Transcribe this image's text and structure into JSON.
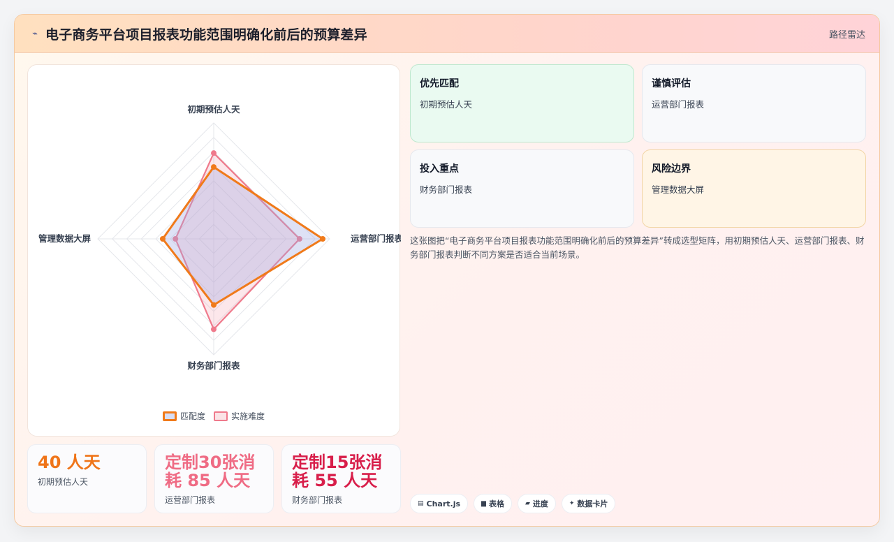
{
  "header": {
    "icon": "line-chart-icon",
    "title": "电子商务平台项目报表功能范围明确化前后的预算差异",
    "nav_label": "路径雷达"
  },
  "chart_data": {
    "type": "radar",
    "axes": [
      "初期预估人天",
      "运营部门报表",
      "财务部门报表",
      "管理数据大屏"
    ],
    "series": [
      {
        "name": "匹配度",
        "values": [
          62,
          94,
          57,
          44
        ],
        "color": "#f07a1a"
      },
      {
        "name": "实施难度",
        "values": [
          74,
          74,
          78,
          33
        ],
        "color": "#ef7a8c"
      }
    ],
    "rmax": 100,
    "rings": 8,
    "legend_position": "bottom"
  },
  "stats": [
    {
      "value": "40 人天",
      "label": "初期预估人天"
    },
    {
      "value": "定制30张消耗 85 人天",
      "label": "运营部门报表"
    },
    {
      "value": "定制15张消耗 55 人天",
      "label": "财务部门报表"
    }
  ],
  "cards": [
    {
      "title": "优先匹配",
      "sub": "初期预估人天"
    },
    {
      "title": "谨慎评估",
      "sub": "运营部门报表"
    },
    {
      "title": "投入重点",
      "sub": "财务部门报表"
    },
    {
      "title": "风险边界",
      "sub": "管理数据大屏"
    }
  ],
  "description": "这张图把“电子商务平台项目报表功能范围明确化前后的预算差异”转成选型矩阵，用初期预估人天、运营部门报表、财务部门报表判断不同方案是否适合当前场景。",
  "chips": [
    {
      "icon": "chart-icon",
      "label": "Chart.js"
    },
    {
      "icon": "table-icon",
      "label": "表格"
    },
    {
      "icon": "progress-icon",
      "label": "进度"
    },
    {
      "icon": "sparkle-icon",
      "label": "数据卡片"
    }
  ]
}
